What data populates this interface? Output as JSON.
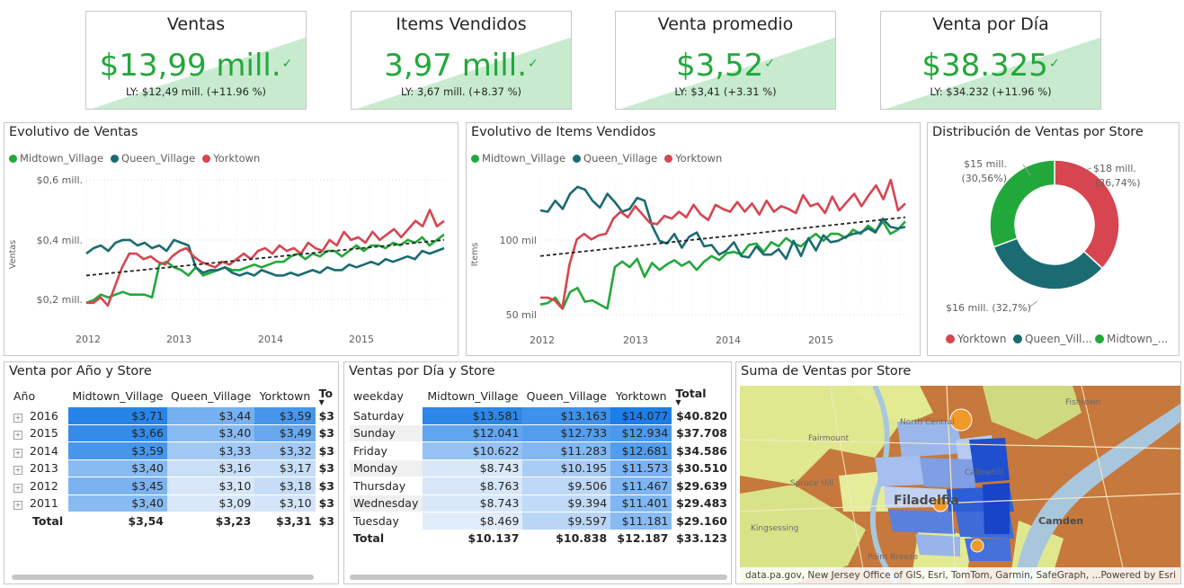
{
  "colors": {
    "midtown": "#22a83a",
    "queen": "#1b6b72",
    "yorktown": "#d64550",
    "kpi_green": "#22a83a"
  },
  "kpis": [
    {
      "title": "Ventas",
      "value": "$13,99 mill.",
      "ly": "LY: $12,49 mill. (+11.96 %)",
      "icon": "check-icon"
    },
    {
      "title": "Items Vendidos",
      "value": "3,97 mill.",
      "ly": "LY: 3,67 mill. (+8.37 %)",
      "icon": "check-icon"
    },
    {
      "title": "Venta promedio",
      "value": "$3,52",
      "ly": "LY: $3,41 (+3.31 %)",
      "icon": "check-icon"
    },
    {
      "title": "Venta por Día",
      "value": "$38.325",
      "ly": "LY: $34.232 (+11.96 %)",
      "icon": "check-icon"
    }
  ],
  "legend_series": [
    "Midtown_Village",
    "Queen_Village",
    "Yorktown"
  ],
  "chart_data": [
    {
      "type": "line",
      "title": "Evolutivo de Ventas",
      "ylabel": "Ventas",
      "y_ticks": [
        "$0,6 mill.",
        "$0,4 mill.",
        "$0,2 mill."
      ],
      "x_ticks": [
        "2012",
        "2013",
        "2014",
        "2015"
      ],
      "ylim": [
        0.13,
        0.63
      ],
      "trendline": {
        "style": "dashed",
        "from": 0.27,
        "to": 0.4
      },
      "series": [
        {
          "name": "Midtown_Village",
          "values": [
            0.17,
            0.18,
            0.2,
            0.19,
            0.2,
            0.21,
            0.2,
            0.2,
            0.2,
            0.19,
            0.31,
            0.32,
            0.3,
            0.29,
            0.27,
            0.3,
            0.27,
            0.28,
            0.29,
            0.3,
            0.29,
            0.29,
            0.3,
            0.31,
            0.3,
            0.31,
            0.32,
            0.32,
            0.34,
            0.35,
            0.33,
            0.35,
            0.34,
            0.36,
            0.36,
            0.34,
            0.36,
            0.38,
            0.36,
            0.38,
            0.38,
            0.37,
            0.39,
            0.38,
            0.4,
            0.39,
            0.41,
            0.38,
            0.4,
            0.42
          ]
        },
        {
          "name": "Queen_Village",
          "values": [
            0.35,
            0.37,
            0.38,
            0.36,
            0.39,
            0.4,
            0.4,
            0.38,
            0.39,
            0.37,
            0.38,
            0.36,
            0.4,
            0.39,
            0.38,
            0.3,
            0.28,
            0.29,
            0.29,
            0.3,
            0.28,
            0.27,
            0.28,
            0.27,
            0.29,
            0.28,
            0.27,
            0.27,
            0.28,
            0.27,
            0.28,
            0.29,
            0.28,
            0.3,
            0.29,
            0.29,
            0.31,
            0.3,
            0.31,
            0.32,
            0.31,
            0.33,
            0.32,
            0.33,
            0.34,
            0.33,
            0.36,
            0.35,
            0.36,
            0.37
          ]
        },
        {
          "name": "Yorktown",
          "values": [
            0.17,
            0.17,
            0.19,
            0.16,
            0.23,
            0.3,
            0.35,
            0.35,
            0.33,
            0.34,
            0.32,
            0.31,
            0.34,
            0.36,
            0.37,
            0.34,
            0.32,
            0.31,
            0.3,
            0.32,
            0.31,
            0.33,
            0.35,
            0.33,
            0.36,
            0.37,
            0.35,
            0.38,
            0.36,
            0.37,
            0.35,
            0.39,
            0.37,
            0.36,
            0.4,
            0.38,
            0.43,
            0.4,
            0.41,
            0.39,
            0.43,
            0.4,
            0.42,
            0.44,
            0.41,
            0.44,
            0.47,
            0.45,
            0.51,
            0.45,
            0.47
          ]
        }
      ]
    },
    {
      "type": "line",
      "title": "Evolutivo de Items Vendidos",
      "ylabel": "Items",
      "y_ticks": [
        "100 mil",
        "50 mil"
      ],
      "x_ticks": [
        "2012",
        "2013",
        "2014",
        "2015"
      ],
      "ylim": [
        45,
        145
      ],
      "trendline": {
        "style": "dashed",
        "from": 88,
        "to": 116
      },
      "series": [
        {
          "name": "Midtown_Village",
          "values": [
            53,
            54,
            58,
            50,
            62,
            65,
            55,
            56,
            53,
            50,
            80,
            84,
            80,
            86,
            73,
            83,
            78,
            82,
            85,
            81,
            84,
            78,
            84,
            88,
            85,
            90,
            91,
            89,
            96,
            97,
            91,
            98,
            95,
            101,
            97,
            95,
            100,
            104,
            99,
            104,
            104,
            101,
            107,
            104,
            110,
            106,
            113,
            104,
            107,
            113
          ]
        },
        {
          "name": "Queen_Village",
          "values": [
            121,
            120,
            128,
            122,
            133,
            138,
            136,
            128,
            123,
            133,
            127,
            120,
            122,
            130,
            128,
            110,
            99,
            97,
            104,
            94,
            102,
            105,
            95,
            96,
            89,
            92,
            98,
            88,
            87,
            95,
            89,
            89,
            93,
            86,
            99,
            88,
            101,
            92,
            103,
            98,
            99,
            102,
            104,
            105,
            108,
            105,
            115,
            109,
            108,
            109
          ]
        },
        {
          "name": "Yorktown",
          "values": [
            58,
            58,
            56,
            50,
            82,
            100,
            104,
            100,
            103,
            104,
            115,
            120,
            116,
            124,
            118,
            112,
            111,
            117,
            115,
            120,
            116,
            125,
            118,
            114,
            125,
            122,
            120,
            127,
            120,
            126,
            118,
            128,
            120,
            124,
            122,
            119,
            132,
            124,
            126,
            119,
            131,
            121,
            127,
            133,
            124,
            132,
            139,
            129,
            143,
            121,
            126
          ]
        }
      ]
    },
    {
      "type": "pie",
      "title": "Distribución de Ventas por Store",
      "slices": [
        {
          "name": "Yorktown",
          "value": 36.74,
          "label": "$18 mill.",
          "pct": "(36,74%)"
        },
        {
          "name": "Queen_Village",
          "value": 32.7,
          "label": "$16 mill. (32,7%)"
        },
        {
          "name": "Midtown_Village",
          "value": 30.56,
          "label": "$15 mill.",
          "pct": "(30,56%)"
        }
      ],
      "legend": [
        "Yorktown",
        "Queen_Vill...",
        "Midtown_..."
      ]
    }
  ],
  "table_year": {
    "title": "Venta por Año y Store",
    "headers": [
      "Año",
      "Midtown_Village",
      "Queen_Village",
      "Yorktown",
      "To"
    ],
    "rows": [
      {
        "label": "2016",
        "vals": [
          "$3,71",
          "$3,44",
          "$3,59",
          "$3"
        ],
        "shade": [
          0.95,
          0.55,
          0.78
        ]
      },
      {
        "label": "2015",
        "vals": [
          "$3,66",
          "$3,40",
          "$3,49",
          "$3"
        ],
        "shade": [
          0.88,
          0.45,
          0.62
        ]
      },
      {
        "label": "2014",
        "vals": [
          "$3,59",
          "$3,33",
          "$3,32",
          "$3"
        ],
        "shade": [
          0.78,
          0.32,
          0.32
        ]
      },
      {
        "label": "2013",
        "vals": [
          "$3,40",
          "$3,16",
          "$3,17",
          "$3"
        ],
        "shade": [
          0.45,
          0.12,
          0.13
        ]
      },
      {
        "label": "2012",
        "vals": [
          "$3,45",
          "$3,10",
          "$3,18",
          "$3"
        ],
        "shade": [
          0.52,
          0.05,
          0.14
        ]
      },
      {
        "label": "2011",
        "vals": [
          "$3,40",
          "$3,09",
          "$3,10",
          "$3"
        ],
        "shade": [
          0.45,
          0.04,
          0.06
        ]
      }
    ],
    "total": {
      "label": "Total",
      "vals": [
        "$3,54",
        "$3,23",
        "$3,31",
        "$3"
      ]
    }
  },
  "table_day": {
    "title": "Ventas por Día y Store",
    "headers": [
      "weekday",
      "Midtown_Village",
      "Queen_Village",
      "Yorktown",
      "Total"
    ],
    "rows": [
      {
        "label": "Saturday",
        "vals": [
          "$13.581",
          "$13.163",
          "$14.077",
          "$40.820"
        ],
        "shade": [
          0.92,
          0.82,
          1.0
        ]
      },
      {
        "label": "Sunday",
        "vals": [
          "$12.041",
          "$12.733",
          "$12.934",
          "$37.708"
        ],
        "shade": [
          0.65,
          0.72,
          0.76
        ]
      },
      {
        "label": "Friday",
        "vals": [
          "$10.622",
          "$11.283",
          "$12.681",
          "$34.586"
        ],
        "shade": [
          0.38,
          0.48,
          0.72
        ]
      },
      {
        "label": "Monday",
        "vals": [
          "$8.743",
          "$10.195",
          "$11.573",
          "$30.510"
        ],
        "shade": [
          0.04,
          0.28,
          0.52
        ]
      },
      {
        "label": "Thursday",
        "vals": [
          "$8.763",
          "$9.506",
          "$11.467",
          "$29.639"
        ],
        "shade": [
          0.05,
          0.18,
          0.5
        ]
      },
      {
        "label": "Wednesday",
        "vals": [
          "$8.743",
          "$9.394",
          "$11.401",
          "$29.483"
        ],
        "shade": [
          0.04,
          0.16,
          0.49
        ]
      },
      {
        "label": "Tuesday",
        "vals": [
          "$8.469",
          "$9.597",
          "$11.181",
          "$29.160"
        ],
        "shade": [
          0.0,
          0.2,
          0.45
        ]
      }
    ],
    "total": {
      "label": "Total",
      "vals": [
        "$10.137",
        "$10.838",
        "$12.187",
        "$33.123"
      ]
    }
  },
  "map": {
    "title": "Suma de Ventas por Store",
    "credit": "data.pa.gov, New Jersey Office of GIS, Esri, TomTom, Garmin, SafeGraph, ...",
    "powered": "Powered by Esri",
    "labels": [
      "North Central",
      "Fishtown",
      "Fairmount",
      "Callowhill",
      "Spruce Hill",
      "Filadelfia",
      "Camden",
      "Kingsessing",
      "Point Breeze"
    ]
  }
}
